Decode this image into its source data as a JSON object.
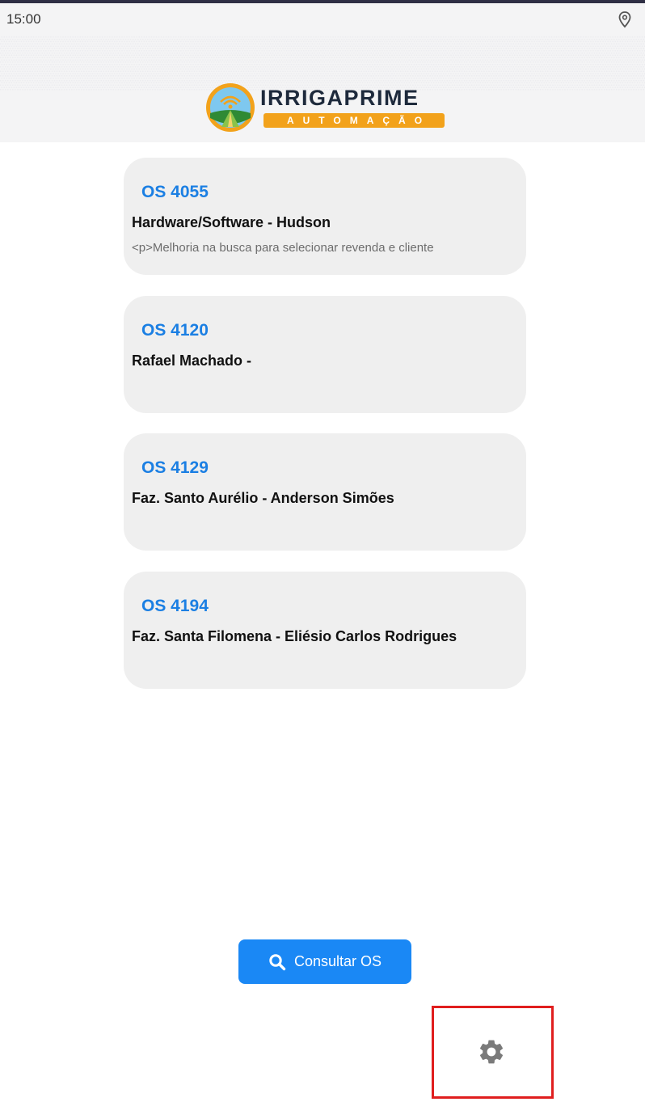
{
  "status_bar": {
    "time": "15:00",
    "location_icon": "location-pin-icon"
  },
  "header": {
    "logo": {
      "title": "IRRIGAPRIME",
      "subtitle": "AUTOMAÇÃO",
      "icon": "irrigation-emblem-icon"
    }
  },
  "orders": [
    {
      "id": "OS 4055",
      "title": "Hardware/Software - Hudson",
      "description": "<p>Melhoria na busca para selecionar revenda e cliente"
    },
    {
      "id": "OS 4120",
      "title": "Rafael Machado -",
      "description": ""
    },
    {
      "id": "OS 4129",
      "title": "Faz. Santo Aurélio - Anderson Simões",
      "description": ""
    },
    {
      "id": "OS 4194",
      "title": "Faz. Santa  Filomena - Eliésio Carlos Rodrigues",
      "description": ""
    }
  ],
  "consult_button": {
    "label": "Consultar OS",
    "icon": "search-icon"
  },
  "settings": {
    "icon": "gear-icon"
  },
  "colors": {
    "accent": "#1a88f5",
    "order_id": "#1b7fe3",
    "card_background": "#efefef",
    "header_background": "#f4f4f5",
    "logo_orange": "#f2a21b",
    "highlight": "#e01e1e"
  }
}
